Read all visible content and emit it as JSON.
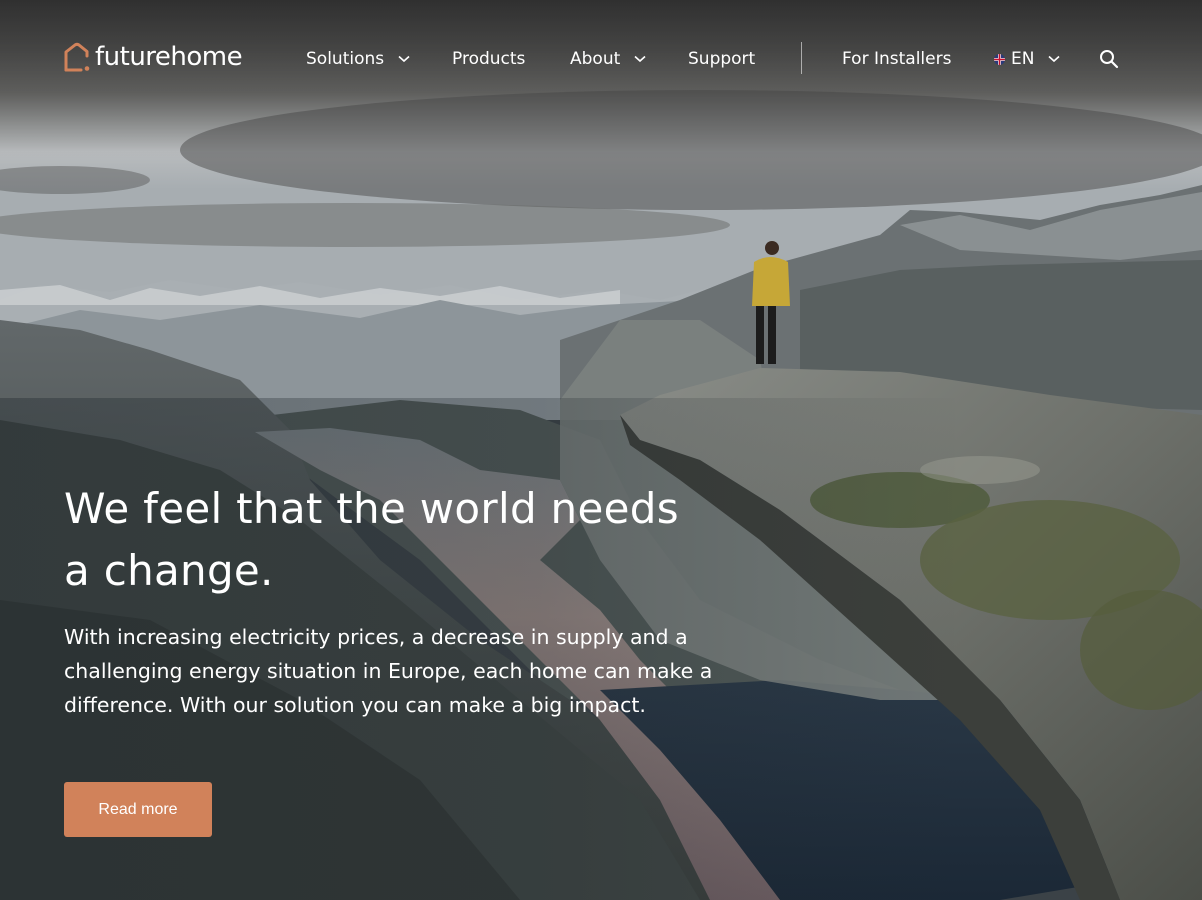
{
  "brand": {
    "name": "futurehome",
    "logo_icon": "house-outline-icon",
    "accent_color": "#d1825a"
  },
  "nav": {
    "items": [
      {
        "label": "Solutions",
        "has_dropdown": true
      },
      {
        "label": "Products",
        "has_dropdown": false
      },
      {
        "label": "About",
        "has_dropdown": true
      },
      {
        "label": "Support",
        "has_dropdown": false
      }
    ],
    "installers_label": "For Installers",
    "language": {
      "label": "EN",
      "flag_icon": "uk-flag-icon",
      "has_dropdown": true
    },
    "search_icon": "search-icon"
  },
  "hero": {
    "title": "We feel that the world needs a change.",
    "body": "With increasing electricity prices, a decrease in supply and a challenging energy situation in Europe, each home can make a difference. With our solution you can make a big impact.",
    "cta_label": "Read more"
  }
}
